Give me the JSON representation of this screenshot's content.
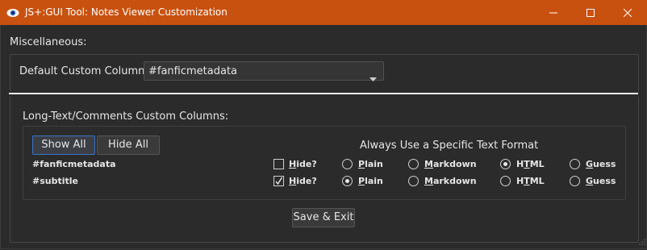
{
  "window": {
    "title": "JS+:GUI Tool:  Notes Viewer Customization",
    "app_icon": "eye-icon",
    "minimize_icon": "minimize-icon",
    "maximize_icon": "maximize-icon",
    "close_icon": "close-icon",
    "titlebar_color": "#c8510f"
  },
  "misc": {
    "label": "Miscellaneous:",
    "default_column_label": "Default Custom Column:",
    "default_column_value": "#fanficmetadata"
  },
  "long_text": {
    "label": "Long-Text/Comments Custom Columns:",
    "show_all": "Show All",
    "hide_all": "Hide All",
    "format_heading": "Always Use a Specific Text Format",
    "rows": [
      {
        "name": "#fanficmetadata",
        "hide_label_first": "H",
        "hide_label_rest": "ide?",
        "hide_checked": false,
        "selected": "HTML"
      },
      {
        "name": "#subtitle",
        "hide_label_first": "H",
        "hide_label_rest": "ide?",
        "hide_checked": true,
        "selected": "Plain"
      }
    ],
    "options": {
      "plain_first": "P",
      "plain_rest": "lain",
      "markdown_first": "M",
      "markdown_rest": "arkdown",
      "html_pre": "H",
      "html_ul": "T",
      "html_post": "ML",
      "guess_first": "G",
      "guess_rest": "uess"
    }
  },
  "footer": {
    "save_exit": "Save & Exit"
  }
}
